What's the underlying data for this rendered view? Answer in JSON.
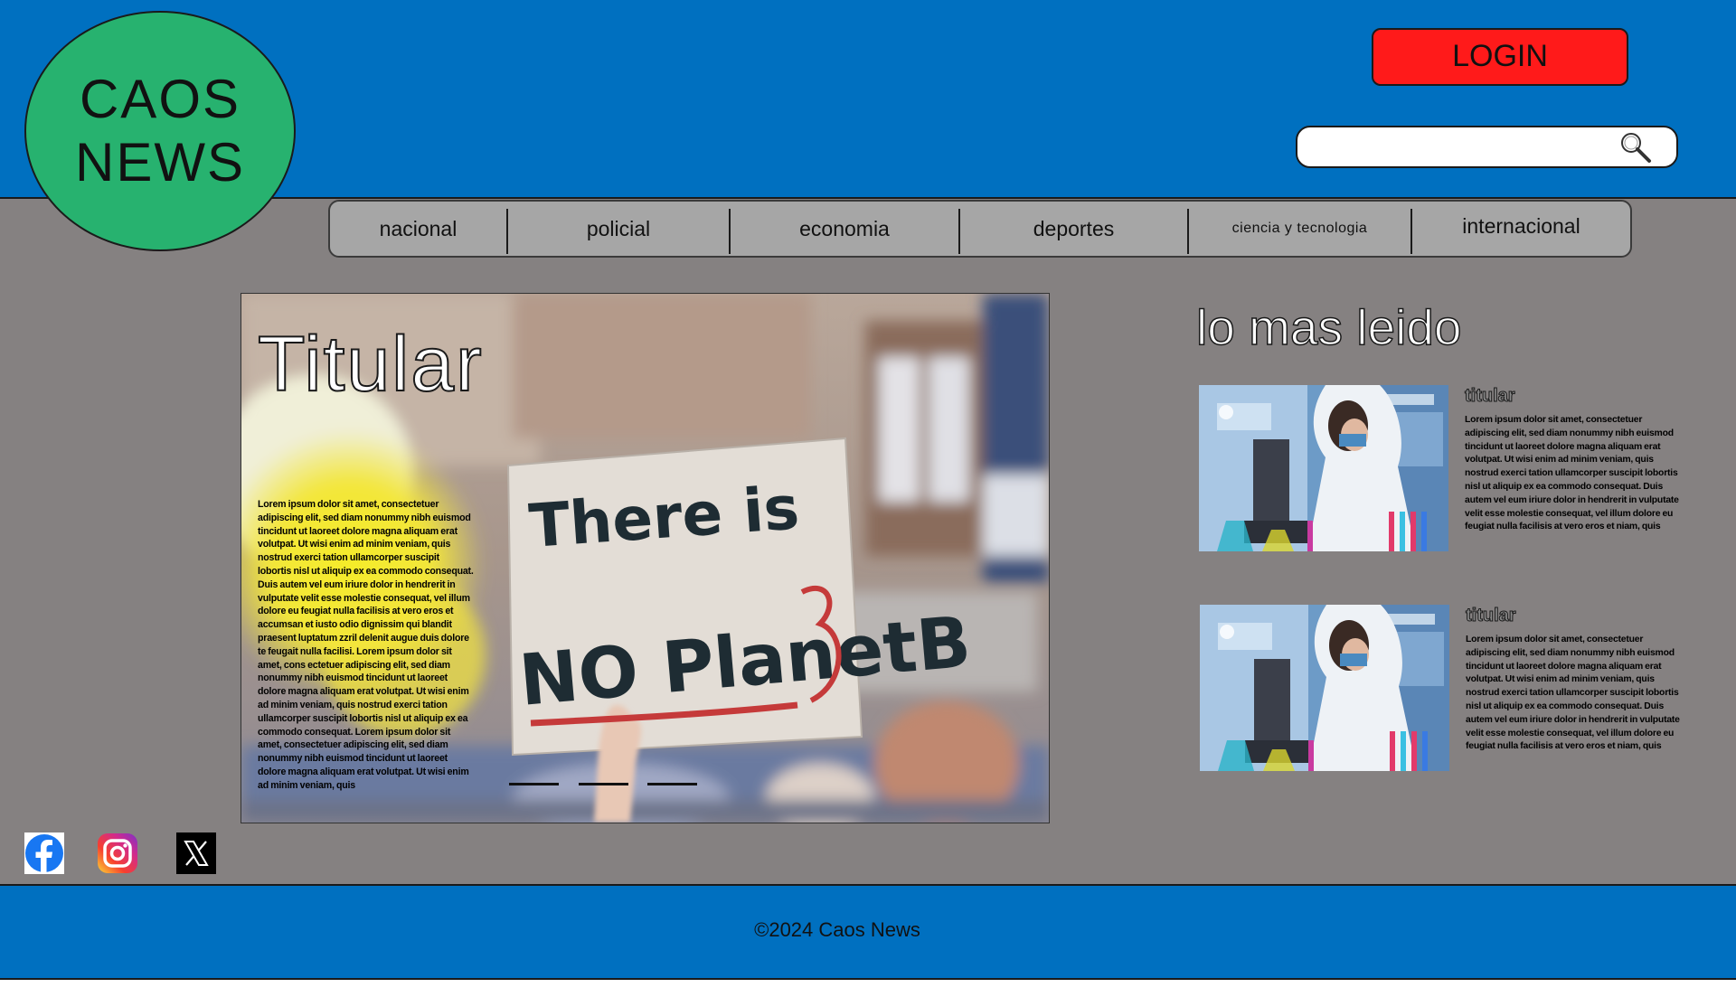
{
  "brand": {
    "logo_line1": "CAOS",
    "logo_line2": "NEWS"
  },
  "header": {
    "login_label": "LOGIN",
    "search": {
      "placeholder": "",
      "value": ""
    }
  },
  "nav": {
    "items": [
      {
        "label": "nacional"
      },
      {
        "label": "policial"
      },
      {
        "label": "economia"
      },
      {
        "label": "deportes"
      },
      {
        "label": "ciencia y tecnologia"
      },
      {
        "label": "internacional"
      }
    ]
  },
  "hero": {
    "title": "Titular",
    "image_sign_line1": "There is",
    "image_sign_line2": "NO PlanetB",
    "body": "Lorem ipsum dolor sit amet, consectetuer adipiscing elit, sed diam nonummy nibh euismod tincidunt ut laoreet dolore magna aliquam erat volutpat. Ut wisi enim ad minim veniam, quis nostrud exerci tation ullamcorper suscipit lobortis nisl ut aliquip ex ea commodo consequat. Duis autem vel eum iriure dolor in hendrerit in vulputate velit esse molestie consequat, vel illum dolore eu feugiat nulla facilisis at vero eros et accumsan et iusto odio dignissim qui blandit praesent luptatum zzril delenit augue duis dolore te feugait nulla facilisi. Lorem ipsum dolor sit amet, cons ectetuer adipiscing elit, sed diam nonummy nibh euismod tincidunt ut laoreet dolore magna aliquam erat volutpat. Ut wisi enim ad minim veniam, quis nostrud exerci tation ullamcorper suscipit lobortis nisl ut aliquip ex ea commodo consequat. Lorem ipsum dolor sit amet, consectetuer adipiscing elit, sed diam nonummy nibh euismod tincidunt ut laoreet dolore magna aliquam erat volutpat. Ut wisi enim ad minim veniam, quis",
    "slide_count": 3
  },
  "most_read": {
    "heading": "lo mas leido",
    "items": [
      {
        "title": "titular",
        "text": "Lorem ipsum dolor sit amet, consectetuer adipiscing elit, sed diam nonummy nibh euismod tincidunt ut laoreet dolore magna aliquam erat volutpat. Ut wisi enim ad minim veniam, quis nostrud exerci tation ullamcorper suscipit lobortis nisl ut aliquip ex ea commodo consequat. Duis autem vel eum iriure dolor in hendrerit in vulputate velit esse molestie consequat, vel illum dolore eu feugiat nulla facilisis at vero eros et niam, quis"
      },
      {
        "title": "titular",
        "text": "Lorem ipsum dolor sit amet, consectetuer adipiscing elit, sed diam nonummy nibh euismod tincidunt ut laoreet dolore magna aliquam erat volutpat. Ut wisi enim ad minim veniam, quis nostrud exerci tation ullamcorper suscipit lobortis nisl ut aliquip ex ea commodo consequat. Duis autem vel eum iriure dolor in hendrerit in vulputate velit esse molestie consequat, vel illum dolore eu feugiat nulla facilisis at vero eros et niam, quis"
      }
    ]
  },
  "social": [
    {
      "name": "facebook-icon"
    },
    {
      "name": "instagram-icon"
    },
    {
      "name": "x-icon"
    }
  ],
  "footer": {
    "copyright": "©2024 Caos News"
  },
  "colors": {
    "header_bg": "#0070c0",
    "main_bg": "#858181",
    "logo_bg": "#27b26f",
    "login_bg": "#ff1a1a",
    "nav_bg": "#a6a6a6"
  }
}
